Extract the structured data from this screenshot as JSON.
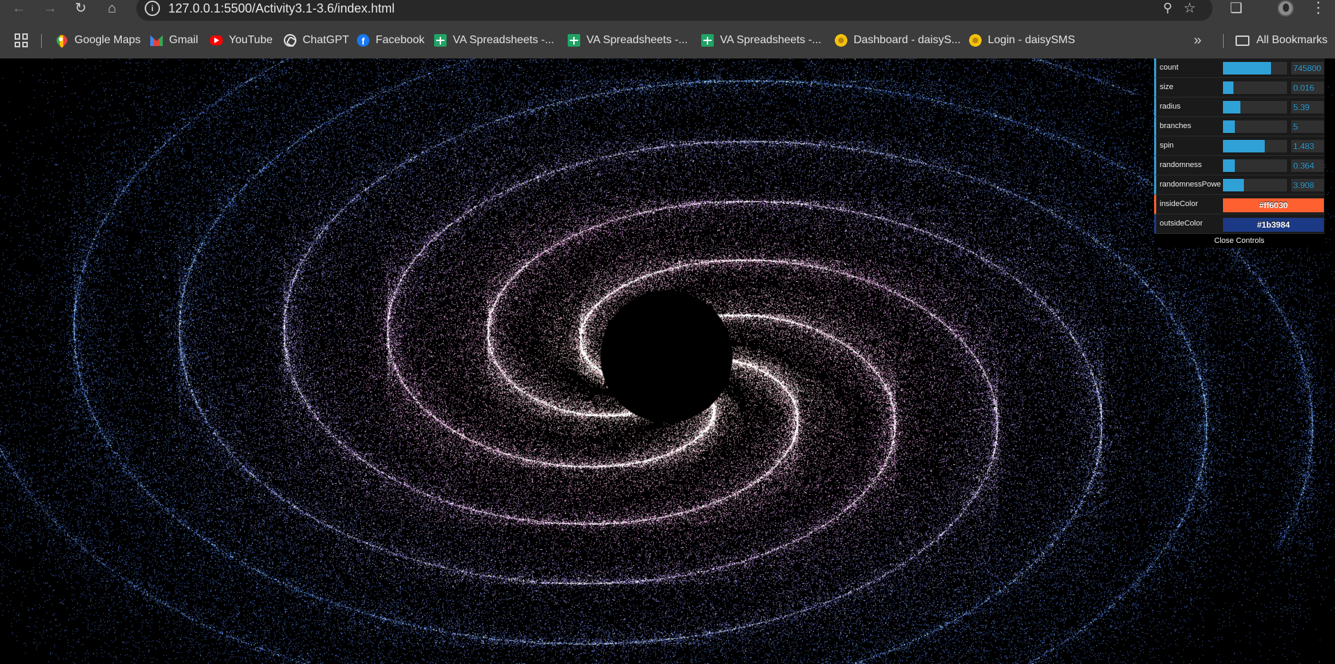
{
  "browser": {
    "url": "127.0.0.1:5500/Activity3.1-3.6/index.html",
    "bookmarks": [
      {
        "label": "Google Maps",
        "icon": "google-maps-icon"
      },
      {
        "label": "Gmail",
        "icon": "gmail-icon"
      },
      {
        "label": "YouTube",
        "icon": "youtube-icon"
      },
      {
        "label": "ChatGPT",
        "icon": "chatgpt-icon"
      },
      {
        "label": "Facebook",
        "icon": "facebook-icon"
      },
      {
        "label": "VA Spreadsheets -...",
        "icon": "google-sheets-icon"
      },
      {
        "label": "VA Spreadsheets -...",
        "icon": "google-sheets-icon"
      },
      {
        "label": "VA Spreadsheets -...",
        "icon": "google-sheets-icon"
      },
      {
        "label": "Dashboard - daisyS...",
        "icon": "daisy-icon"
      },
      {
        "label": "Login - daisySMS",
        "icon": "daisy-icon"
      }
    ],
    "all_bookmarks_label": "All Bookmarks"
  },
  "gui": {
    "controls": [
      {
        "label": "count",
        "value": "745800",
        "fraction": 0.75
      },
      {
        "label": "size",
        "value": "0.016",
        "fraction": 0.16
      },
      {
        "label": "radius",
        "value": "5.39",
        "fraction": 0.27
      },
      {
        "label": "branches",
        "value": "5",
        "fraction": 0.18
      },
      {
        "label": "spin",
        "value": "1.483",
        "fraction": 0.65
      },
      {
        "label": "randomness",
        "value": "0.364",
        "fraction": 0.18
      },
      {
        "label": "randomnessPower",
        "value": "3.908",
        "fraction": 0.33
      }
    ],
    "colors": [
      {
        "label": "insideColor",
        "value": "#ff6030",
        "bg": "#ff6030"
      },
      {
        "label": "outsideColor",
        "value": "#1b3984",
        "bg": "#1b3984"
      }
    ],
    "close_label": "Close Controls"
  },
  "galaxy": {
    "insideColor": "#ff6030",
    "outsideColor": "#1b3984",
    "branches": 5,
    "spin": 1.483,
    "randomness": 0.364,
    "randomnessPower": 3.908
  }
}
